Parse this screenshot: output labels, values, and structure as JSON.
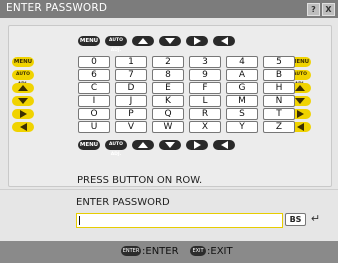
{
  "window": {
    "title": "ENTER PASSWORD",
    "help_label": "?",
    "close_label": "X"
  },
  "labels": {
    "menu": "MENU",
    "autoadj": "AUTO ADJ."
  },
  "keys": [
    [
      "0",
      "1",
      "2",
      "3",
      "4",
      "5"
    ],
    [
      "6",
      "7",
      "8",
      "9",
      "A",
      "B"
    ],
    [
      "C",
      "D",
      "E",
      "F",
      "G",
      "H"
    ],
    [
      "I",
      "J",
      "K",
      "L",
      "M",
      "N"
    ],
    [
      "O",
      "P",
      "Q",
      "R",
      "S",
      "T"
    ],
    [
      "U",
      "V",
      "W",
      "X",
      "Y",
      "Z"
    ]
  ],
  "message": "PRESS BUTTON ON ROW.",
  "password": {
    "label": "ENTER PASSWORD",
    "value": "",
    "backspace_label": "BS",
    "enter_icon": "↵"
  },
  "footer": {
    "enter_badge": "ENTER",
    "enter_label": ":ENTER",
    "exit_badge": "EXIT",
    "exit_label": ":EXIT"
  },
  "colors": {
    "title_bar": "#7c7c7c",
    "yellow": "#f0d300",
    "dark_button": "#2a2a2a"
  }
}
